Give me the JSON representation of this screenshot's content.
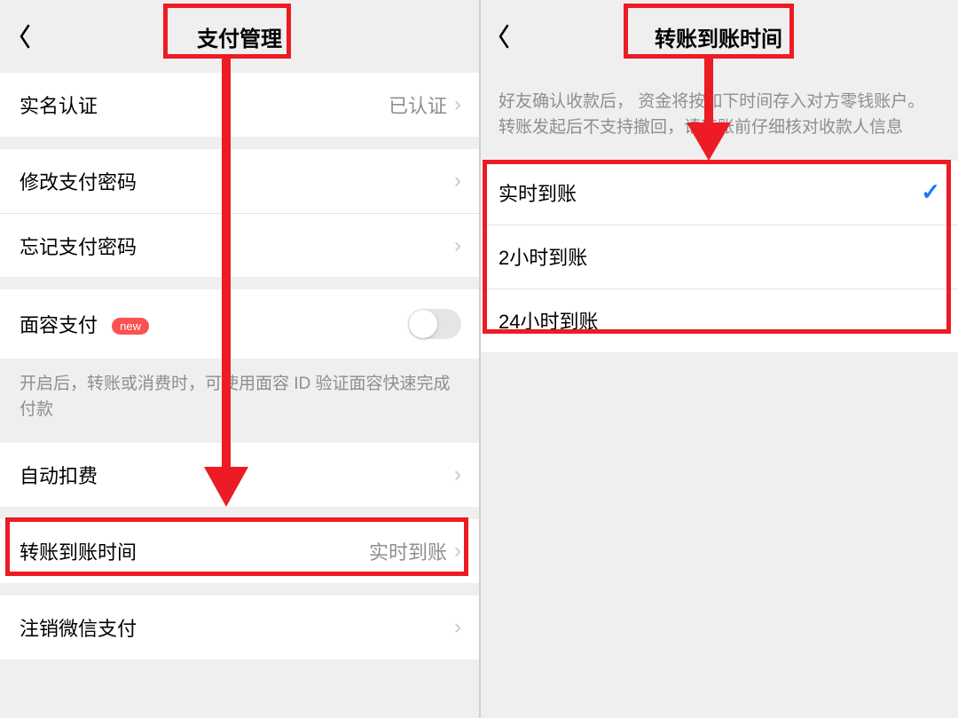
{
  "left": {
    "header": {
      "title": "支付管理"
    },
    "rows": {
      "realname": {
        "label": "实名认证",
        "value": "已认证"
      },
      "changePwd": {
        "label": "修改支付密码"
      },
      "forgotPwd": {
        "label": "忘记支付密码"
      },
      "facePay": {
        "label": "面容支付",
        "badge": "new"
      },
      "facePayHint": "开启后，转账或消费时，可使用面容 ID 验证面容快速完成付款",
      "autoDebit": {
        "label": "自动扣费"
      },
      "transferTime": {
        "label": "转账到账时间",
        "value": "实时到账"
      },
      "closeAccount": {
        "label": "注销微信支付"
      }
    }
  },
  "right": {
    "header": {
      "title": "转账到账时间"
    },
    "hint": "好友确认收款后， 资金将按如下时间存入对方零钱账户。转账发起后不支持撤回，请转账前仔细核对收款人信息",
    "options": {
      "0": {
        "label": "实时到账",
        "selected": true
      },
      "1": {
        "label": "2小时到账",
        "selected": false
      },
      "2": {
        "label": "24小时到账",
        "selected": false
      }
    }
  }
}
